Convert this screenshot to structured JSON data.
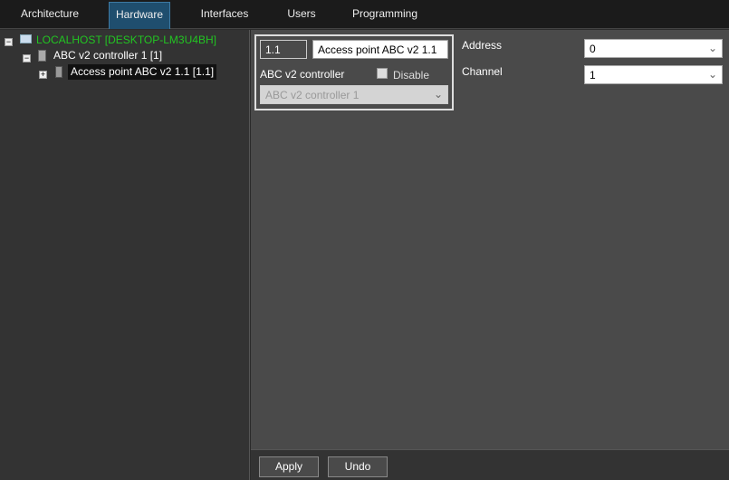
{
  "tabs": [
    "Architecture",
    "Hardware",
    "Interfaces",
    "Users",
    "Programming"
  ],
  "tree": {
    "root": "LOCALHOST [DESKTOP-LM3U4BH]",
    "controller": "ABC v2 controller 1 [1]",
    "access_point": "Access point ABC v2 1.1 [1.1]"
  },
  "form": {
    "id_value": "1.1",
    "name_value": "Access point ABC v2 1.1",
    "controller_label": "ABC v2 controller",
    "disable_label": "Disable",
    "controller_value": "ABC v2 controller 1",
    "address_label": "Address",
    "address_value": "0",
    "channel_label": "Channel",
    "channel_value": "1"
  },
  "buttons": {
    "apply": "Apply",
    "undo": "Undo"
  },
  "colors": {
    "root_green": "#22c422",
    "active_tab": "#1f4e6e"
  }
}
